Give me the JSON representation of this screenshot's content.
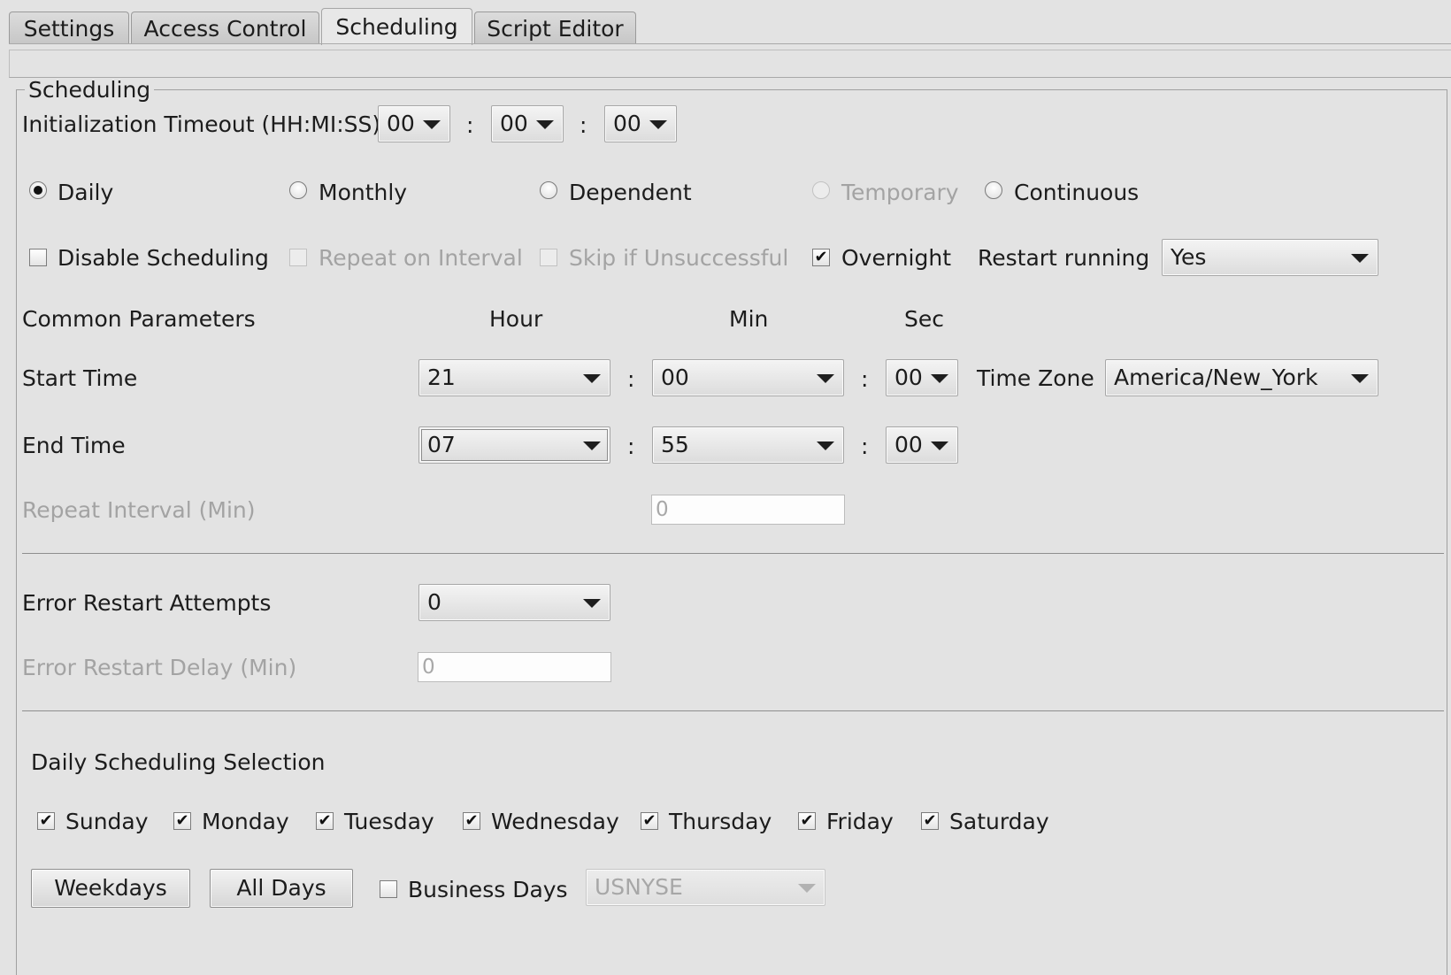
{
  "tabs": [
    {
      "label": "Settings"
    },
    {
      "label": "Access Control"
    },
    {
      "label": "Scheduling"
    },
    {
      "label": "Script Editor"
    }
  ],
  "group_title": "Scheduling",
  "init_timeout": {
    "label": "Initialization Timeout (HH:MI:SS)",
    "hh": "00",
    "mi": "00",
    "ss": "00",
    "sep": ":"
  },
  "schedule_types": {
    "daily": "Daily",
    "monthly": "Monthly",
    "dependent": "Dependent",
    "temporary": "Temporary",
    "continuous": "Continuous",
    "selected": "Daily"
  },
  "options": {
    "disable_scheduling": "Disable Scheduling",
    "repeat_on_interval": "Repeat on Interval",
    "skip_if_unsuccessful": "Skip if Unsuccessful",
    "overnight": "Overnight",
    "restart_running_label": "Restart running",
    "restart_running_value": "Yes",
    "check_mark": "✔"
  },
  "common": {
    "label": "Common Parameters",
    "hour": "Hour",
    "min": "Min",
    "sec": "Sec"
  },
  "start_time": {
    "label": "Start Time",
    "hour": "21",
    "min": "00",
    "sec": "00",
    "timezone_label": "Time Zone",
    "timezone": "America/New_York"
  },
  "end_time": {
    "label": "End Time",
    "hour": "07",
    "min": "55",
    "sec": "00"
  },
  "repeat_interval": {
    "label": "Repeat Interval (Min)",
    "value": "0"
  },
  "error_restart": {
    "attempts_label": "Error Restart Attempts",
    "attempts": "0",
    "delay_label": "Error Restart Delay (Min)",
    "delay": "0"
  },
  "daily_selection": {
    "title": "Daily Scheduling Selection",
    "days": [
      "Sunday",
      "Monday",
      "Tuesday",
      "Wednesday",
      "Thursday",
      "Friday",
      "Saturday"
    ],
    "weekdays_button": "Weekdays",
    "all_days_button": "All Days",
    "business_days": "Business Days",
    "calendar": "USNYSE"
  }
}
